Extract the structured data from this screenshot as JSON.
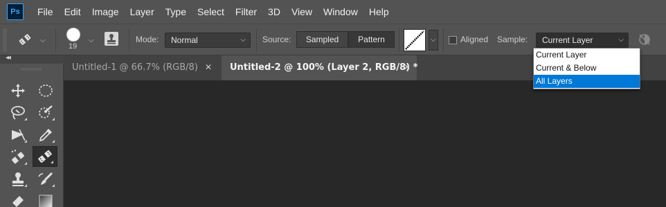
{
  "app": {
    "logo_text": "Ps"
  },
  "menu": [
    "File",
    "Edit",
    "Image",
    "Layer",
    "Type",
    "Select",
    "Filter",
    "3D",
    "View",
    "Window",
    "Help"
  ],
  "options_bar": {
    "brush_size": "19",
    "mode_label": "Mode:",
    "mode_value": "Normal",
    "source_label": "Source:",
    "source_sampled": "Sampled",
    "source_pattern": "Pattern",
    "aligned_label": "Aligned",
    "aligned_checked": false,
    "sample_label": "Sample:",
    "sample_value": "Current Layer"
  },
  "sample_dropdown": {
    "options": [
      "Current Layer",
      "Current & Below",
      "All Layers"
    ],
    "highlighted": "All Layers"
  },
  "tabs": [
    {
      "title": "Untitled-1 @ 66.7% (RGB/8)",
      "active": false,
      "close": "✕"
    },
    {
      "title": "Untitled-2 @ 100% (Layer 2, RGB/8) *",
      "active": true,
      "close": "✕"
    }
  ],
  "tools": [
    {
      "name": "move-tool",
      "icon": "move-icon"
    },
    {
      "name": "elliptical-marquee-tool",
      "icon": "ellipse-marquee-icon"
    },
    {
      "name": "lasso-tool",
      "icon": "lasso-icon"
    },
    {
      "name": "quick-selection-tool",
      "icon": "quick-selection-icon"
    },
    {
      "name": "crop-tool",
      "icon": "crop-icon"
    },
    {
      "name": "eyedropper-tool",
      "icon": "eyedropper-icon"
    },
    {
      "name": "spot-healing-tool",
      "icon": "spot-healing-icon"
    },
    {
      "name": "patch-tool",
      "icon": "patch-icon",
      "selected": true
    },
    {
      "name": "clone-stamp-tool",
      "icon": "stamp-icon"
    },
    {
      "name": "history-brush-tool",
      "icon": "history-brush-icon"
    },
    {
      "name": "eraser-tool",
      "icon": "eraser-icon"
    },
    {
      "name": "gradient-tool",
      "icon": "gradient-icon"
    }
  ],
  "colors": {
    "panel": "#535353",
    "canvas": "#282828",
    "highlight": "#0078d7",
    "ps_blue": "#31a8ff"
  }
}
